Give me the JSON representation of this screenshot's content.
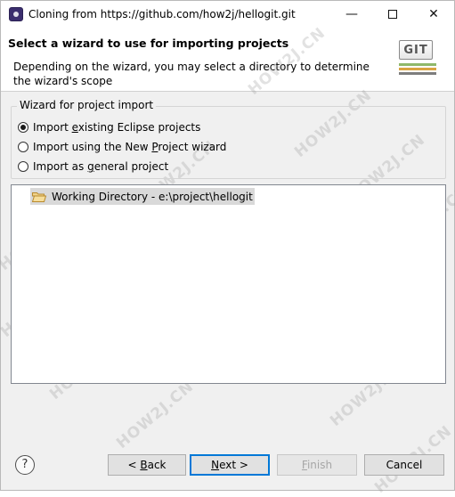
{
  "window": {
    "title": "Cloning from https://github.com/how2j/hellogit.git",
    "minimize_glyph": "—",
    "close_glyph": "✕"
  },
  "header": {
    "title": "Select a wizard to use for importing projects",
    "description": "Depending on the wizard, you may select a directory to determine the wizard's scope",
    "logo_text": "GIT"
  },
  "wizard_group": {
    "label": "Wizard for project import",
    "options": [
      {
        "pre": "Import ",
        "mnemonic": "e",
        "post": "xisting Eclipse projects",
        "checked": true
      },
      {
        "pre": "Import using the New ",
        "mnemonic": "P",
        "post": "roject wizard",
        "checked": false
      },
      {
        "pre": "Import as ",
        "mnemonic": "g",
        "post": "eneral project",
        "checked": false
      }
    ]
  },
  "tree": {
    "item_label": "Working Directory - e:\\project\\hellogit",
    "item_icon": "folder-open-icon"
  },
  "footer": {
    "help_glyph": "?",
    "back": {
      "pre": "< ",
      "mnemonic": "B",
      "post": "ack"
    },
    "next": {
      "pre": "",
      "mnemonic": "N",
      "post": "ext >"
    },
    "finish": {
      "pre": "",
      "mnemonic": "F",
      "post": "inish"
    },
    "cancel": "Cancel"
  },
  "watermark": {
    "text": "HOW2J.CN",
    "color": "#969696"
  },
  "colors": {
    "default_button_border": "#0078d7",
    "selection_bg": "#d9d9d9",
    "dialog_bg": "#f0f0f0"
  }
}
